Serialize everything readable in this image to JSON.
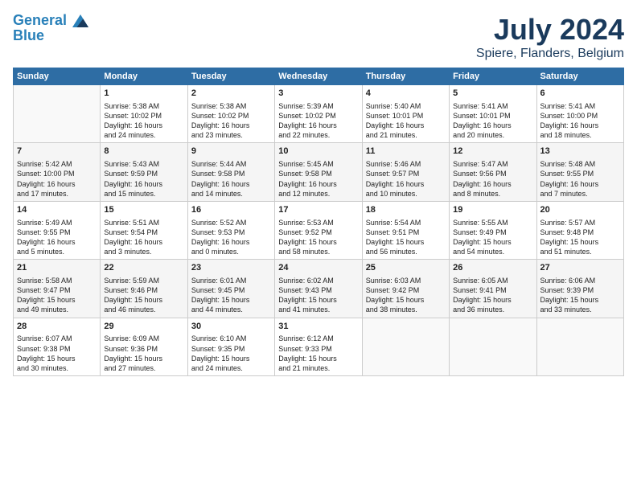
{
  "header": {
    "logo_line1": "General",
    "logo_line2": "Blue",
    "title": "July 2024",
    "subtitle": "Spiere, Flanders, Belgium"
  },
  "weekdays": [
    "Sunday",
    "Monday",
    "Tuesday",
    "Wednesday",
    "Thursday",
    "Friday",
    "Saturday"
  ],
  "weeks": [
    [
      {
        "day": "",
        "info": ""
      },
      {
        "day": "1",
        "info": "Sunrise: 5:38 AM\nSunset: 10:02 PM\nDaylight: 16 hours\nand 24 minutes."
      },
      {
        "day": "2",
        "info": "Sunrise: 5:38 AM\nSunset: 10:02 PM\nDaylight: 16 hours\nand 23 minutes."
      },
      {
        "day": "3",
        "info": "Sunrise: 5:39 AM\nSunset: 10:02 PM\nDaylight: 16 hours\nand 22 minutes."
      },
      {
        "day": "4",
        "info": "Sunrise: 5:40 AM\nSunset: 10:01 PM\nDaylight: 16 hours\nand 21 minutes."
      },
      {
        "day": "5",
        "info": "Sunrise: 5:41 AM\nSunset: 10:01 PM\nDaylight: 16 hours\nand 20 minutes."
      },
      {
        "day": "6",
        "info": "Sunrise: 5:41 AM\nSunset: 10:00 PM\nDaylight: 16 hours\nand 18 minutes."
      }
    ],
    [
      {
        "day": "7",
        "info": "Sunrise: 5:42 AM\nSunset: 10:00 PM\nDaylight: 16 hours\nand 17 minutes."
      },
      {
        "day": "8",
        "info": "Sunrise: 5:43 AM\nSunset: 9:59 PM\nDaylight: 16 hours\nand 15 minutes."
      },
      {
        "day": "9",
        "info": "Sunrise: 5:44 AM\nSunset: 9:58 PM\nDaylight: 16 hours\nand 14 minutes."
      },
      {
        "day": "10",
        "info": "Sunrise: 5:45 AM\nSunset: 9:58 PM\nDaylight: 16 hours\nand 12 minutes."
      },
      {
        "day": "11",
        "info": "Sunrise: 5:46 AM\nSunset: 9:57 PM\nDaylight: 16 hours\nand 10 minutes."
      },
      {
        "day": "12",
        "info": "Sunrise: 5:47 AM\nSunset: 9:56 PM\nDaylight: 16 hours\nand 8 minutes."
      },
      {
        "day": "13",
        "info": "Sunrise: 5:48 AM\nSunset: 9:55 PM\nDaylight: 16 hours\nand 7 minutes."
      }
    ],
    [
      {
        "day": "14",
        "info": "Sunrise: 5:49 AM\nSunset: 9:55 PM\nDaylight: 16 hours\nand 5 minutes."
      },
      {
        "day": "15",
        "info": "Sunrise: 5:51 AM\nSunset: 9:54 PM\nDaylight: 16 hours\nand 3 minutes."
      },
      {
        "day": "16",
        "info": "Sunrise: 5:52 AM\nSunset: 9:53 PM\nDaylight: 16 hours\nand 0 minutes."
      },
      {
        "day": "17",
        "info": "Sunrise: 5:53 AM\nSunset: 9:52 PM\nDaylight: 15 hours\nand 58 minutes."
      },
      {
        "day": "18",
        "info": "Sunrise: 5:54 AM\nSunset: 9:51 PM\nDaylight: 15 hours\nand 56 minutes."
      },
      {
        "day": "19",
        "info": "Sunrise: 5:55 AM\nSunset: 9:49 PM\nDaylight: 15 hours\nand 54 minutes."
      },
      {
        "day": "20",
        "info": "Sunrise: 5:57 AM\nSunset: 9:48 PM\nDaylight: 15 hours\nand 51 minutes."
      }
    ],
    [
      {
        "day": "21",
        "info": "Sunrise: 5:58 AM\nSunset: 9:47 PM\nDaylight: 15 hours\nand 49 minutes."
      },
      {
        "day": "22",
        "info": "Sunrise: 5:59 AM\nSunset: 9:46 PM\nDaylight: 15 hours\nand 46 minutes."
      },
      {
        "day": "23",
        "info": "Sunrise: 6:01 AM\nSunset: 9:45 PM\nDaylight: 15 hours\nand 44 minutes."
      },
      {
        "day": "24",
        "info": "Sunrise: 6:02 AM\nSunset: 9:43 PM\nDaylight: 15 hours\nand 41 minutes."
      },
      {
        "day": "25",
        "info": "Sunrise: 6:03 AM\nSunset: 9:42 PM\nDaylight: 15 hours\nand 38 minutes."
      },
      {
        "day": "26",
        "info": "Sunrise: 6:05 AM\nSunset: 9:41 PM\nDaylight: 15 hours\nand 36 minutes."
      },
      {
        "day": "27",
        "info": "Sunrise: 6:06 AM\nSunset: 9:39 PM\nDaylight: 15 hours\nand 33 minutes."
      }
    ],
    [
      {
        "day": "28",
        "info": "Sunrise: 6:07 AM\nSunset: 9:38 PM\nDaylight: 15 hours\nand 30 minutes."
      },
      {
        "day": "29",
        "info": "Sunrise: 6:09 AM\nSunset: 9:36 PM\nDaylight: 15 hours\nand 27 minutes."
      },
      {
        "day": "30",
        "info": "Sunrise: 6:10 AM\nSunset: 9:35 PM\nDaylight: 15 hours\nand 24 minutes."
      },
      {
        "day": "31",
        "info": "Sunrise: 6:12 AM\nSunset: 9:33 PM\nDaylight: 15 hours\nand 21 minutes."
      },
      {
        "day": "",
        "info": ""
      },
      {
        "day": "",
        "info": ""
      },
      {
        "day": "",
        "info": ""
      }
    ]
  ]
}
